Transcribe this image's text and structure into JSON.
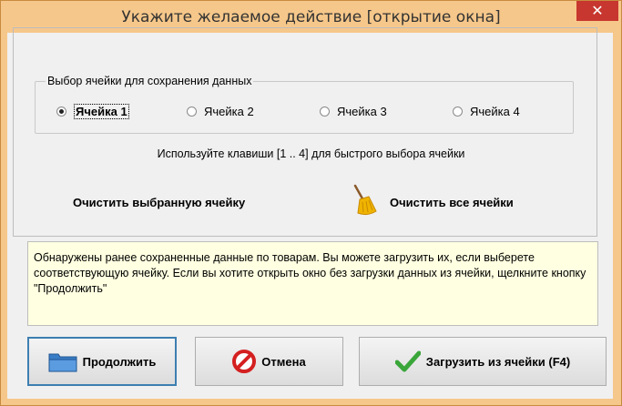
{
  "window": {
    "title": "Укажите желаемое действие [открытие окна]",
    "close_label": "✕"
  },
  "cells": {
    "legend": "Выбор ячейки для сохранения данных",
    "options": [
      {
        "label": "Ячейка 1",
        "checked": true
      },
      {
        "label": "Ячейка 2",
        "checked": false
      },
      {
        "label": "Ячейка 3",
        "checked": false
      },
      {
        "label": "Ячейка 4",
        "checked": false
      }
    ],
    "hint": "Используйте клавиши [1 .. 4] для быстрого выбора ячейки"
  },
  "actions": {
    "clear_selected": "Очистить выбранную ячейку",
    "clear_all": "Очистить все ячейки"
  },
  "info": {
    "text": "Обнаружены ранее сохраненные данные по товарам. Вы можете загрузить их, если выберете соответствующую ячейку. Если вы хотите открыть окно без загрузки данных из ячейки, щелкните кнопку \"Продолжить\""
  },
  "buttons": {
    "continue": "Продолжить",
    "cancel": "Отмена",
    "load": "Загрузить из ячейки (F4)"
  },
  "colors": {
    "titlebar": "#f6c78a",
    "close": "#c7372f",
    "info_bg": "#ffffe1",
    "focus_border": "#3c7fb1"
  },
  "icons": {
    "continue": "folder-icon",
    "cancel": "no-entry-icon",
    "load": "checkmark-icon",
    "clear_all": "broom-icon"
  }
}
